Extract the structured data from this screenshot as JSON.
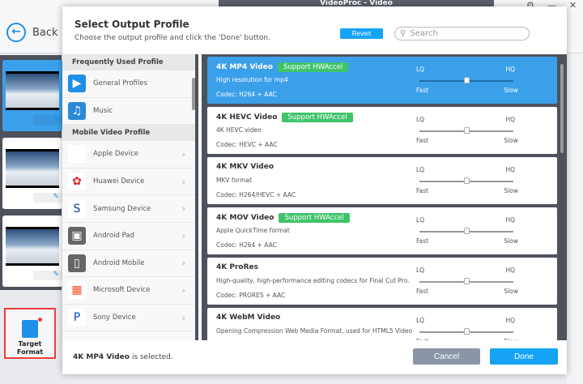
{
  "app": {
    "title": "VideoProc - Video",
    "back_label": "Back",
    "target_format_label": "Target Format"
  },
  "colors": {
    "accent": "#16a3f5",
    "selected_card": "#3ba0ea",
    "hwaccel": "#3fc46a",
    "highlight_box": "#f03c3c"
  },
  "modal": {
    "title": "Select Output Profile",
    "subtitle": "Choose the output profile and click the 'Done' button.",
    "revert_label": "Revert",
    "search_placeholder": "Search",
    "categories": [
      {
        "header": "Frequently Used Profile",
        "items": [
          {
            "label": "General Profiles",
            "icon": "monitor-icon"
          },
          {
            "label": "Music",
            "icon": "music-icon"
          }
        ]
      },
      {
        "header": "Mobile Video Profile",
        "items": [
          {
            "label": "Apple Device",
            "icon": "apple-icon"
          },
          {
            "label": "Huawei Device",
            "icon": "huawei-icon"
          },
          {
            "label": "Samsung Device",
            "icon": "samsung-icon"
          },
          {
            "label": "Android Pad",
            "icon": "android-pad-icon"
          },
          {
            "label": "Android Mobile",
            "icon": "android-mobile-icon"
          },
          {
            "label": "Microsoft Device",
            "icon": "microsoft-icon"
          },
          {
            "label": "Sony Device",
            "icon": "playstation-icon"
          }
        ]
      }
    ],
    "slider_labels": {
      "lq": "LQ",
      "hq": "HQ",
      "fast": "Fast",
      "slow": "Slow"
    },
    "profiles": [
      {
        "name": "4K MP4 Video",
        "hwaccel": "Support HWAccel",
        "desc": "High resolution for mp4",
        "codec": "Codec: H264 + AAC",
        "selected": true,
        "quality": 0.5
      },
      {
        "name": "4K HEVC Video",
        "hwaccel": "Support HWAccel",
        "desc": "4K HEVC video",
        "codec": "Codec: HEVC + AAC",
        "selected": false,
        "quality": 0.5
      },
      {
        "name": "4K MKV Video",
        "hwaccel": "",
        "desc": "MKV format",
        "codec": "Codec: H264/HEVC + AAC",
        "selected": false,
        "quality": 0.5
      },
      {
        "name": "4K MOV Video",
        "hwaccel": "Support HWAccel",
        "desc": "Apple QuickTime format",
        "codec": "Codec: H264 + AAC",
        "selected": false,
        "quality": 0.5
      },
      {
        "name": "4K ProRes",
        "hwaccel": "",
        "desc": "High-quality, high-performance editing codecs for Final Cut Pro.",
        "codec": "Codec: PRORES + AAC",
        "selected": false,
        "quality": 0.5
      },
      {
        "name": "4K WebM Video",
        "hwaccel": "",
        "desc": "Opening Compression Web Media Format, used for HTML5 Video",
        "codec": "",
        "selected": false,
        "quality": 0.5
      }
    ],
    "status_name": "4K MP4 Video",
    "status_suffix": " is selected.",
    "cancel_label": "Cancel",
    "done_label": "Done"
  }
}
